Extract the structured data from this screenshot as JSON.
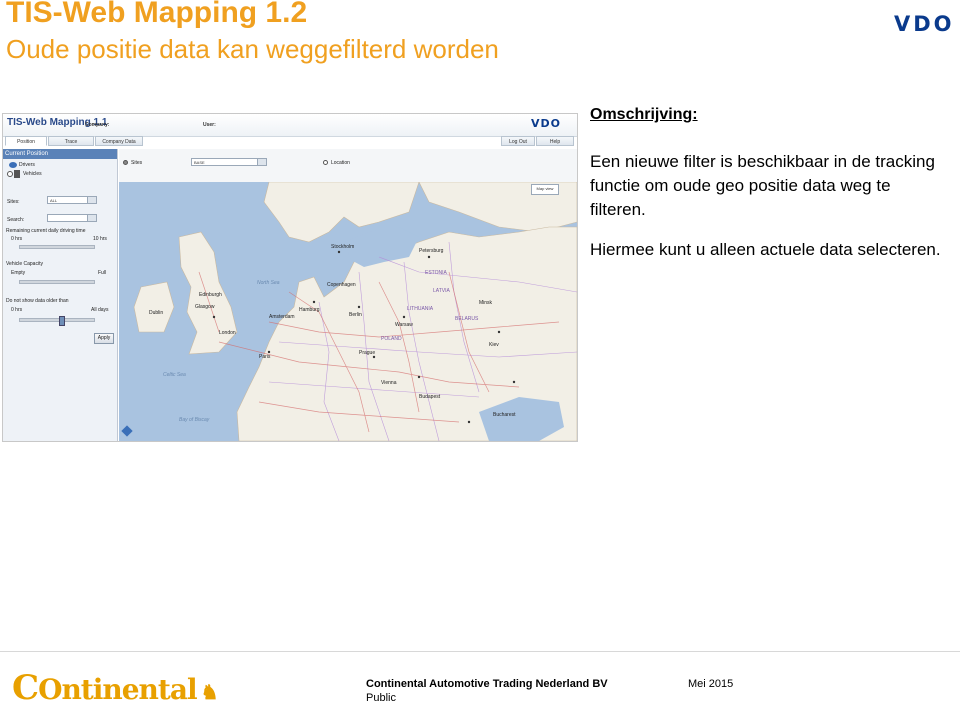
{
  "slide": {
    "title": "TIS-Web Mapping 1.2",
    "subtitle": "Oude positie data kan weggefilterd worden",
    "brand_logo": "VDO"
  },
  "screenshot": {
    "app_title": "TIS-Web Mapping 1.1",
    "company_label": "Company:",
    "user_label": "User:",
    "brand_logo": "VDO",
    "tabs": [
      {
        "label": "Position",
        "active": true
      },
      {
        "label": "Trace",
        "active": false
      },
      {
        "label": "Company Data",
        "active": false
      }
    ],
    "logout_label": "Log Out",
    "help_label": "Help",
    "panel": {
      "header": "Current Position",
      "drivers_label": "Drivers",
      "vehicles_label": "Vehicles",
      "sites_label": "Sites:",
      "sites_value": "ALL",
      "search_label": "Search:",
      "search_value": "",
      "driving_time_label": "Remaining current daily driving time",
      "driving_min": "0 hrs",
      "driving_max": "10 hrs",
      "capacity_label": "Vehicle Capacity",
      "capacity_min": "Empty",
      "capacity_max": "Full",
      "older_label": "Do not show data older than",
      "older_min": "0 hrs",
      "older_max": "All days",
      "apply_label": "Apply"
    },
    "top_strip": {
      "sites_option": "Sites",
      "sites_select_value": "BASE",
      "location_option": "Location"
    },
    "map": {
      "map_view_label": "Map view",
      "sea_labels": [
        "North Sea",
        "Celtic Sea",
        "Bay of Biscay"
      ],
      "city_labels": [
        "Stockholm",
        "Petersburg",
        "Edinburgh",
        "Glasgow",
        "Copenhagen",
        "Hamburg",
        "Berlin",
        "Warsaw",
        "Minsk",
        "London",
        "Amsterdam",
        "Prague",
        "Kiev",
        "Paris",
        "Vienna",
        "Budapest",
        "Bucharest",
        "Dublin"
      ],
      "country_labels": [
        "ESTONIA",
        "LATVIA",
        "LITHUANIA",
        "BELARUS",
        "POLAND"
      ]
    },
    "colors": {
      "panel_header": "#5a82b8",
      "land": "#f2efe6",
      "sea": "#a9c3e0",
      "road": "#d46a6a"
    }
  },
  "description": {
    "heading": "Omschrijving:",
    "paragraph1": "Een nieuwe filter is beschikbaar in de tracking functie om oude geo positie data weg te filteren.",
    "paragraph2": "Hiermee kunt u alleen actuele data selecteren."
  },
  "footer": {
    "logo_text": "Ontinental",
    "company": "Continental Automotive Trading Nederland BV",
    "classification": "Public",
    "date": "Mei 2015"
  }
}
